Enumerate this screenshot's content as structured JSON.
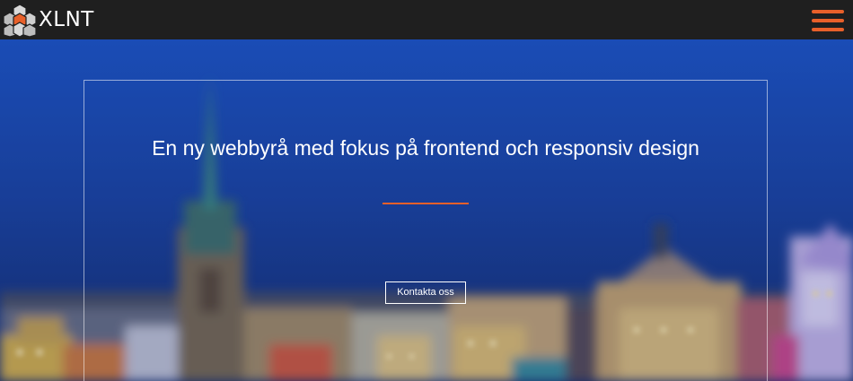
{
  "header": {
    "logo_text": "XLNT",
    "logo_icon": "hexagon-cluster-logo",
    "menu_icon": "hamburger-menu-icon"
  },
  "hero": {
    "heading": "En ny webbyrå med fokus på frontend och responsiv design",
    "cta_label": "Kontakta oss"
  },
  "colors": {
    "navbar": "#1f1f1f",
    "accent": "#e8602a",
    "sky": "#1f4aa6",
    "text": "#ffffff"
  }
}
